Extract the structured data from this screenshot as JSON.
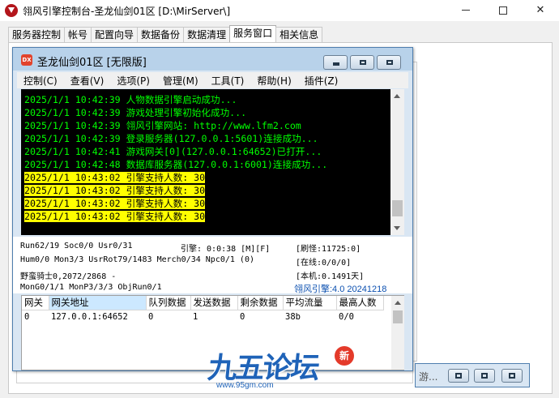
{
  "window": {
    "title": "翎风引擎控制台-圣龙仙剑01区 [D:\\MirServer\\]"
  },
  "tabs": [
    "服务器控制",
    "帐号",
    "配置向导",
    "数据备份",
    "数据清理",
    "服务窗口",
    "相关信息"
  ],
  "active_tab": "服务窗口",
  "inner_window": {
    "icon_label": "DX",
    "title": "圣龙仙剑01区 [无限版]",
    "menu": [
      "控制(C)",
      "查看(V)",
      "选项(P)",
      "管理(M)",
      "工具(T)",
      "帮助(H)",
      "插件(Z)"
    ]
  },
  "console": {
    "lines": [
      "2025/1/1 10:42:39 人物数据引擎启动成功...",
      "2025/1/1 10:42:39 游戏处理引擎初始化成功...",
      "2025/1/1 10:42:39 翎风引擎网站: http://www.lfm2.com",
      "2025/1/1 10:42:39 登录服务器(127.0.0.1:5601)连接成功...",
      "2025/1/1 10:42:41 游戏网关[0](127.0.0.1:64652)已打开...",
      "2025/1/1 10:42:48 数据库服务器(127.0.0.1:6001)连接成功..."
    ],
    "highlighted_lines": [
      "2025/1/1 10:43:02 引擎支持人数: 30",
      "2025/1/1 10:43:02 引擎支持人数: 30",
      "2025/1/1 10:43:02 引擎支持人数: 30",
      "2025/1/1 10:43:02 引擎支持人数: 30"
    ],
    "text_color": "#00ff00",
    "highlight_color": "#ffff00"
  },
  "status": {
    "run_line": "Run62/19 Soc0/0 Usr0/31",
    "engine_time": "引擎: 0:0:38 [M][F]",
    "refresh": "[刷怪:11725:0]",
    "hum_line": "Hum0/0 Mon3/3 UsrRot79/1483 Merch0/34 Npc0/1 (0)",
    "online": "[在线:0/0/0]",
    "boss_line": "野蛮骑士0,2072/2868 -",
    "local": "[本机:0.1491天]",
    "mon_line": "MonG0/1/1 MonP3/3/3 ObjRun0/1",
    "version": "翎风引擎:4.0 20241218"
  },
  "gateway_table": {
    "columns": [
      "网关",
      "网关地址",
      "队列数据",
      "发送数据",
      "剩余数据",
      "平均流量",
      "最高人数"
    ],
    "rows": [
      [
        "0",
        "127.0.0.1:64652",
        "0",
        "1",
        "0",
        "38b",
        "0/0"
      ]
    ]
  },
  "minimized_window": {
    "title": "游..."
  },
  "watermark": {
    "text": "九五论坛",
    "badge": "新",
    "url": "www.95gm.com"
  }
}
